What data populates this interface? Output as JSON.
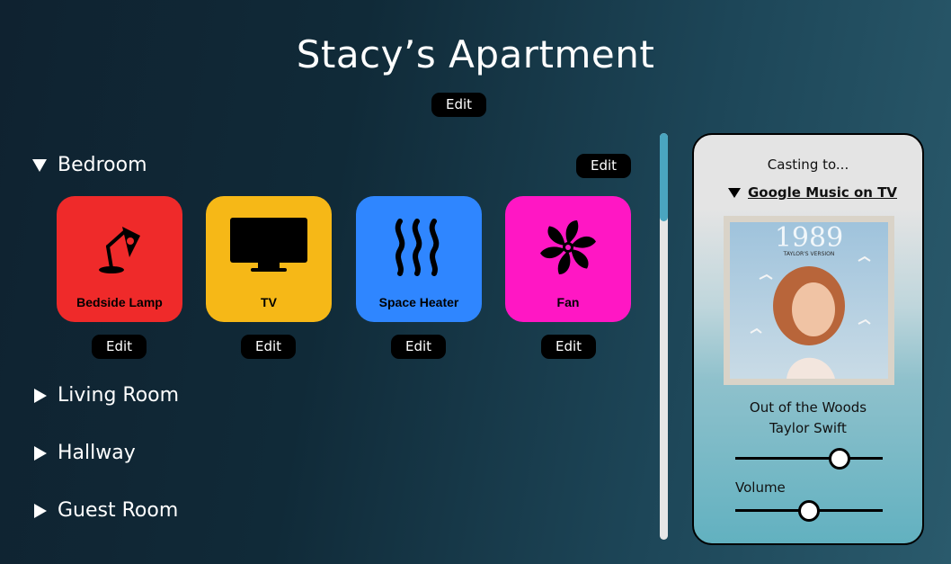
{
  "header": {
    "title": "Stacy’s Apartment",
    "edit_label": "Edit"
  },
  "rooms": [
    {
      "name": "Bedroom",
      "expanded": true,
      "edit_label": "Edit"
    },
    {
      "name": "Living Room",
      "expanded": false
    },
    {
      "name": "Hallway",
      "expanded": false
    },
    {
      "name": "Guest Room",
      "expanded": false
    }
  ],
  "devices": [
    {
      "label": "Bedside Lamp",
      "icon": "lamp-icon",
      "color": "#ef2a2a",
      "edit_label": "Edit"
    },
    {
      "label": "TV",
      "icon": "tv-icon",
      "color": "#f6b817",
      "edit_label": "Edit"
    },
    {
      "label": "Space Heater",
      "icon": "heater-icon",
      "color": "#2f86ff",
      "edit_label": "Edit"
    },
    {
      "label": "Fan",
      "icon": "fan-icon",
      "color": "#ff17c4",
      "edit_label": "Edit"
    }
  ],
  "player": {
    "casting_label": "Casting to...",
    "device": "Google Music on TV",
    "album_title": "1989",
    "album_subtitle": "TAYLOR'S VERSION",
    "song": "Out of the Woods",
    "artist": "Taylor Swift",
    "progress": 0.71,
    "volume_label": "Volume",
    "volume": 0.5
  }
}
